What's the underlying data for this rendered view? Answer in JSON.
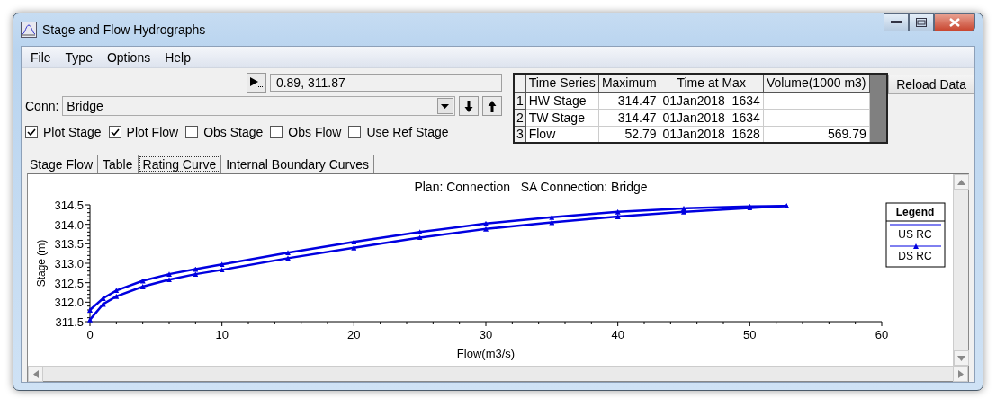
{
  "window": {
    "title": "Stage and Flow Hydrographs"
  },
  "menu": [
    "File",
    "Type",
    "Options",
    "Help"
  ],
  "coordinates": {
    "value": "0.89, 311.87"
  },
  "conn": {
    "label": "Conn:",
    "value": "Bridge"
  },
  "checkboxes": [
    {
      "label": "Plot Stage",
      "checked": true
    },
    {
      "label": "Plot Flow",
      "checked": true
    },
    {
      "label": "Obs Stage",
      "checked": false
    },
    {
      "label": "Obs Flow",
      "checked": false
    },
    {
      "label": "Use Ref Stage",
      "checked": false
    }
  ],
  "summary_table": {
    "columns": [
      "Time Series",
      "Maximum",
      "Time at Max",
      "Volume(1000 m3)"
    ],
    "rows": [
      {
        "number": "1",
        "series": "HW Stage",
        "maximum": "314.47",
        "time_at_max": "01Jan2018  1634"
      },
      {
        "number": "2",
        "series": "TW Stage",
        "maximum": "314.47",
        "time_at_max": "01Jan2018  1634"
      },
      {
        "number": "3",
        "series": "Flow",
        "maximum": "52.79",
        "time_at_max": "01Jan2018  1628",
        "volume": "569.79"
      }
    ]
  },
  "reload_button": "Reload Data",
  "tabs": [
    {
      "label": "Stage Flow",
      "selected": false
    },
    {
      "label": "Table",
      "selected": false
    },
    {
      "label": "Rating Curve",
      "selected": true
    },
    {
      "label": "Internal Boundary Curves",
      "selected": false
    }
  ],
  "chart_data": {
    "type": "line",
    "title": "Plan: Connection   SA Connection: Bridge",
    "xlabel": "Flow(m3/s)",
    "ylabel": "Stage (m)",
    "legend": {
      "title": "Legend"
    },
    "x": [
      0,
      1,
      2,
      4,
      6,
      8,
      10,
      15,
      20,
      25,
      30,
      35,
      40,
      45,
      50,
      52.79
    ],
    "series": [
      {
        "name": "US RC",
        "color": "#0000e0",
        "values": [
          311.8,
          312.1,
          312.3,
          312.55,
          312.72,
          312.85,
          312.97,
          313.27,
          313.55,
          313.8,
          314.02,
          314.18,
          314.32,
          314.41,
          314.46,
          314.47
        ]
      },
      {
        "name": "DS RC",
        "color": "#0000e0",
        "values": [
          311.55,
          311.95,
          312.15,
          312.4,
          312.58,
          312.72,
          312.83,
          313.13,
          313.4,
          313.66,
          313.88,
          314.05,
          314.2,
          314.32,
          314.42,
          314.47
        ]
      }
    ],
    "xlim": [
      0,
      60
    ],
    "ylim": [
      311.5,
      314.5
    ],
    "xticks": [
      0,
      10,
      20,
      30,
      40,
      50,
      60
    ],
    "yticks": [
      {
        "value": 311.5,
        "label": "311.5"
      },
      {
        "value": 312,
        "label": "312.0"
      },
      {
        "value": 312.5,
        "label": "312.5"
      },
      {
        "value": 313,
        "label": "313.0"
      },
      {
        "value": 313.5,
        "label": "313.5"
      },
      {
        "value": 314,
        "label": "314.0"
      },
      {
        "value": 314.5,
        "label": "314.5"
      }
    ]
  }
}
